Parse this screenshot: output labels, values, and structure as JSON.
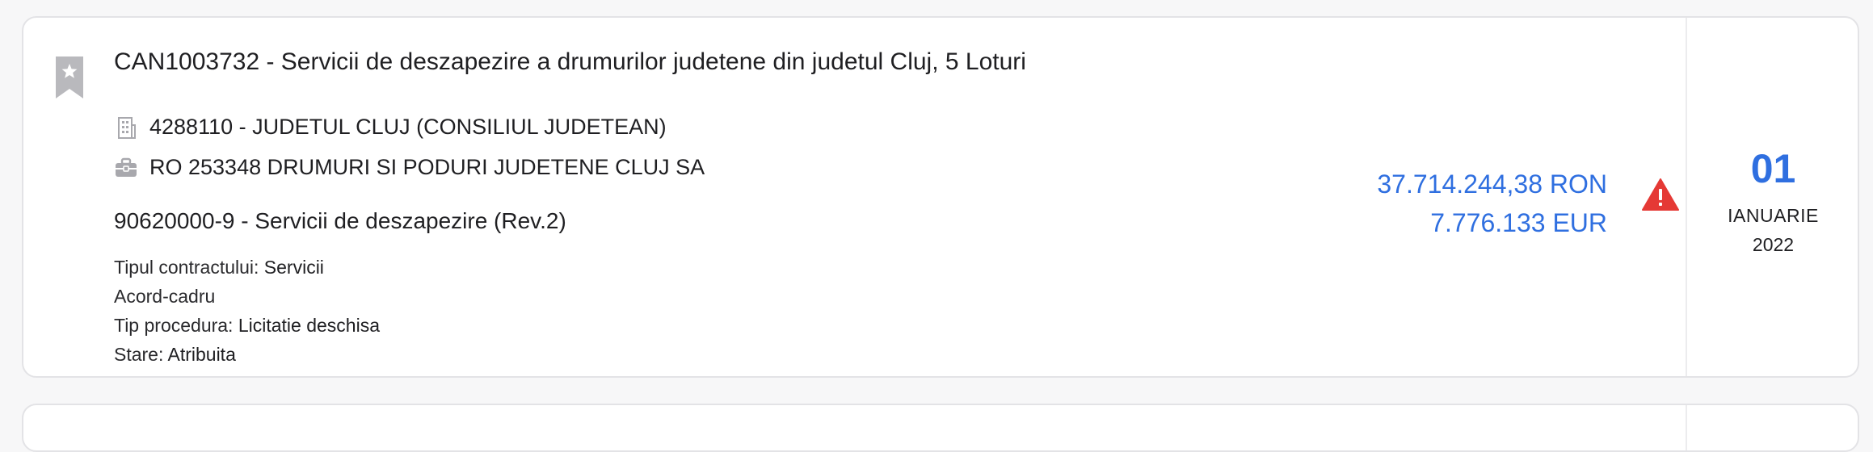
{
  "notice": {
    "title": "CAN1003732 - Servicii de deszapezire a drumurilor judetene din judetul Cluj, 5 Loturi",
    "authority": "4288110 - JUDETUL CLUJ (CONSILIUL JUDETEAN)",
    "supplier": "RO 253348 DRUMURI SI PODURI JUDETENE CLUJ SA",
    "cpv": "90620000-9 - Servicii de deszapezire (Rev.2)",
    "contract_type_label": "Tipul contractului: ",
    "contract_type": "Servicii",
    "agreement": "Acord-cadru",
    "procedure_label": "Tip procedura: ",
    "procedure": "Licitatie deschisa",
    "state_label": "Stare: ",
    "state": "Atribuita",
    "amount_ron": "37.714.244,38 RON",
    "amount_eur": "7.776.133 EUR",
    "date_day": "01",
    "date_month": "IANUARIE",
    "date_year": "2022"
  },
  "icons": {
    "bookmark": "bookmark-star-icon",
    "authority": "building-icon",
    "supplier": "briefcase-icon",
    "warning": "warning-triangle-icon"
  },
  "colors": {
    "accent": "#2f6fe0",
    "warning": "#e53935",
    "bookmark": "#b9b9bd"
  }
}
